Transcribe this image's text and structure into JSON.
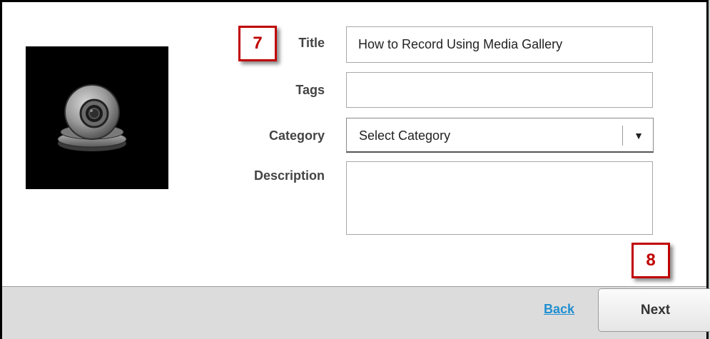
{
  "form": {
    "title_label": "Title",
    "title_value": "How to Record Using Media Gallery",
    "tags_label": "Tags",
    "tags_value": "",
    "category_label": "Category",
    "category_selected": "Select Category",
    "description_label": "Description",
    "description_value": ""
  },
  "thumbnail": {
    "icon": "webcam-icon"
  },
  "callouts": {
    "step7": "7",
    "step8": "8"
  },
  "footer": {
    "back_label": "Back",
    "next_label": "Next"
  },
  "colors": {
    "callout_red": "#c00000",
    "link_blue": "#1f8fd0",
    "footer_gray": "#dcdcdc"
  }
}
